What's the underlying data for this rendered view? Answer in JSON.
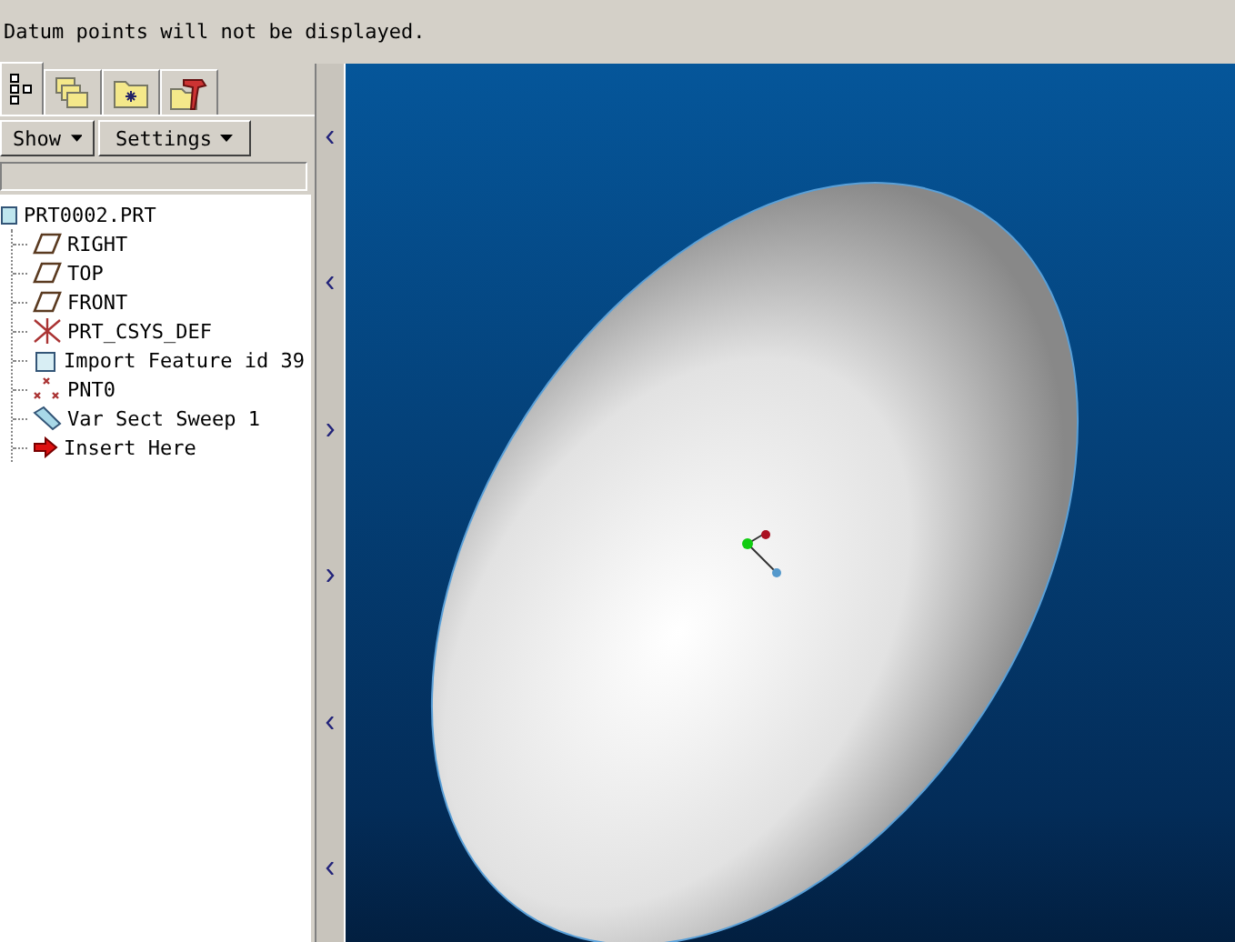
{
  "message_bar": {
    "text": "Datum points will not be displayed."
  },
  "tabs": [
    {
      "kind": "tree",
      "selected": true
    },
    {
      "kind": "layers",
      "selected": false
    },
    {
      "kind": "folder",
      "selected": false
    },
    {
      "kind": "tools",
      "selected": false
    }
  ],
  "toolbar": {
    "buttons": [
      "Show",
      "Settings"
    ]
  },
  "model_tree": [
    {
      "label": "PRT0002.PRT",
      "kind": "part",
      "children": [
        {
          "label": "RIGHT",
          "kind": "plane"
        },
        {
          "label": "TOP",
          "kind": "plane"
        },
        {
          "label": "FRONT",
          "kind": "plane"
        },
        {
          "label": "PRT_CSYS_DEF",
          "kind": "csys"
        },
        {
          "label": "Import Feature id 39",
          "kind": "import"
        },
        {
          "label": "PNT0",
          "kind": "point"
        },
        {
          "label": "Var Sect Sweep 1",
          "kind": "sweep"
        },
        {
          "label": "Insert Here",
          "kind": "insert"
        }
      ]
    }
  ]
}
